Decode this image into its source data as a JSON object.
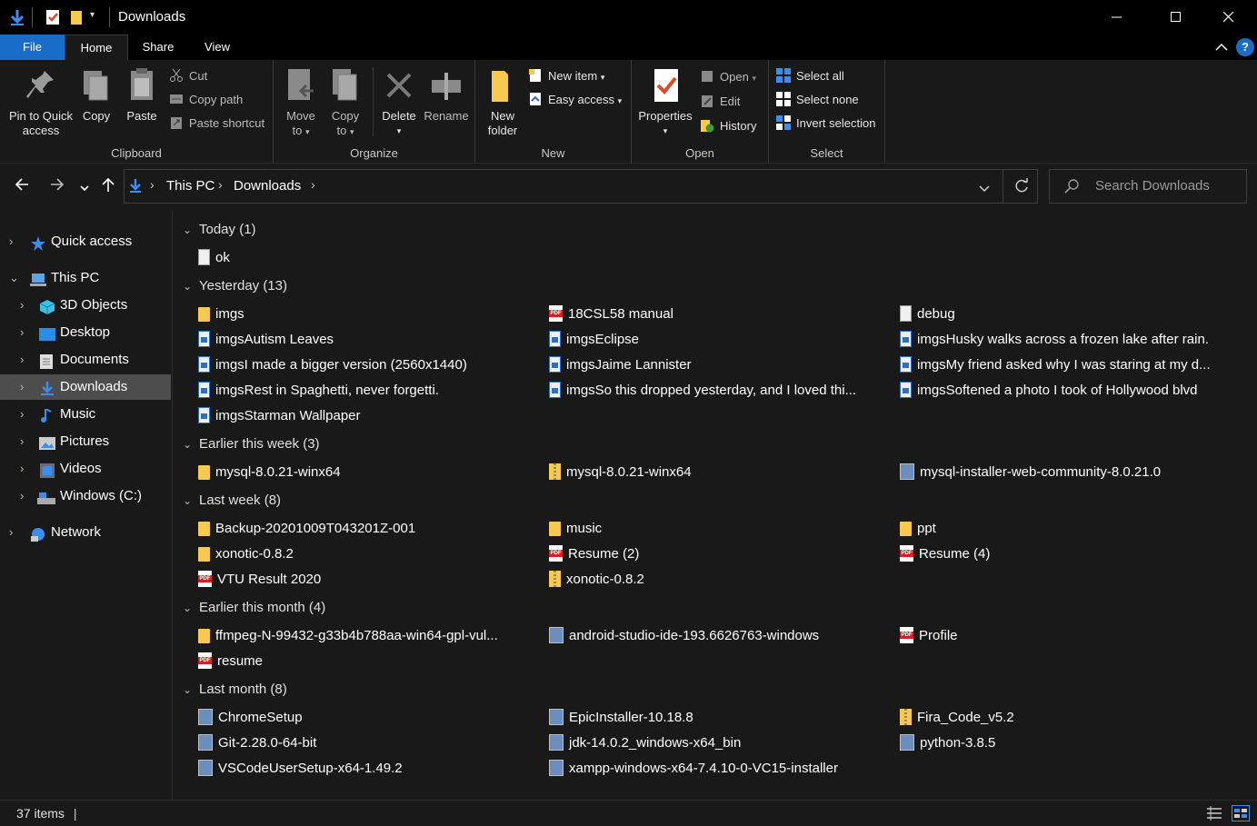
{
  "window": {
    "title": "Downloads",
    "accent": "#1a6cc9"
  },
  "ribbon_tabs": [
    "File",
    "Home",
    "Share",
    "View"
  ],
  "ribbon": {
    "clipboard": {
      "label": "Clipboard",
      "pin_line1": "Pin to Quick",
      "pin_line2": "access",
      "copy": "Copy",
      "paste": "Paste",
      "cut": "Cut",
      "copy_path": "Copy path",
      "paste_shortcut": "Paste shortcut"
    },
    "organize": {
      "label": "Organize",
      "move_line1": "Move",
      "move_line2": "to",
      "copy_line1": "Copy",
      "copy_line2": "to",
      "delete": "Delete",
      "rename": "Rename"
    },
    "new": {
      "label": "New",
      "new_folder_line1": "New",
      "new_folder_line2": "folder",
      "new_item": "New item",
      "easy_access": "Easy access"
    },
    "open": {
      "label": "Open",
      "properties": "Properties",
      "open": "Open",
      "edit": "Edit",
      "history": "History"
    },
    "select": {
      "label": "Select",
      "select_all": "Select all",
      "select_none": "Select none",
      "invert_selection": "Invert selection"
    }
  },
  "address": {
    "crumbs": [
      "This PC",
      "Downloads"
    ],
    "search_placeholder": "Search Downloads"
  },
  "sidebar": {
    "items": [
      {
        "label": "Quick access",
        "icon": "star-icon"
      },
      {
        "label": "This PC",
        "icon": "pc-icon"
      },
      {
        "label": "3D Objects",
        "icon": "cube-icon"
      },
      {
        "label": "Desktop",
        "icon": "desktop-icon"
      },
      {
        "label": "Documents",
        "icon": "documents-icon"
      },
      {
        "label": "Downloads",
        "icon": "download-icon"
      },
      {
        "label": "Music",
        "icon": "music-icon"
      },
      {
        "label": "Pictures",
        "icon": "pictures-icon"
      },
      {
        "label": "Videos",
        "icon": "videos-icon"
      },
      {
        "label": "Windows (C:)",
        "icon": "drive-icon"
      },
      {
        "label": "Network",
        "icon": "network-icon"
      }
    ]
  },
  "groups": [
    {
      "header": "Today (1)",
      "files": [
        {
          "name": "ok",
          "type": "doc"
        }
      ]
    },
    {
      "header": "Yesterday (13)",
      "files": [
        {
          "name": "imgs",
          "type": "folder"
        },
        {
          "name": "18CSL58 manual",
          "type": "pdf"
        },
        {
          "name": "debug",
          "type": "doc"
        },
        {
          "name": "imgsAutism Leaves",
          "type": "img"
        },
        {
          "name": "imgsEclipse",
          "type": "img"
        },
        {
          "name": "imgsHusky walks across a frozen lake after rain.",
          "type": "img"
        },
        {
          "name": "imgsI made a bigger version (2560x1440)",
          "type": "img"
        },
        {
          "name": "imgsJaime Lannister",
          "type": "img"
        },
        {
          "name": "imgsMy friend asked why I was staring at my d...",
          "type": "img"
        },
        {
          "name": "imgsRest in Spaghetti, never forgetti.",
          "type": "img"
        },
        {
          "name": "imgsSo this dropped yesterday, and I loved thi...",
          "type": "img"
        },
        {
          "name": "imgsSoftened a photo I took of Hollywood blvd",
          "type": "img"
        },
        {
          "name": "imgsStarman Wallpaper",
          "type": "img"
        }
      ]
    },
    {
      "header": "Earlier this week (3)",
      "files": [
        {
          "name": "mysql-8.0.21-winx64",
          "type": "folder"
        },
        {
          "name": "mysql-8.0.21-winx64",
          "type": "zip"
        },
        {
          "name": "mysql-installer-web-community-8.0.21.0",
          "type": "exe"
        }
      ]
    },
    {
      "header": "Last week (8)",
      "files": [
        {
          "name": "Backup-20201009T043201Z-001",
          "type": "folder"
        },
        {
          "name": "music",
          "type": "folder"
        },
        {
          "name": "ppt",
          "type": "folder"
        },
        {
          "name": "xonotic-0.8.2",
          "type": "folder"
        },
        {
          "name": "Resume (2)",
          "type": "pdf"
        },
        {
          "name": "Resume (4)",
          "type": "pdf"
        },
        {
          "name": "VTU Result 2020",
          "type": "pdf"
        },
        {
          "name": "xonotic-0.8.2",
          "type": "zip"
        }
      ]
    },
    {
      "header": "Earlier this month (4)",
      "files": [
        {
          "name": "ffmpeg-N-99432-g33b4b788aa-win64-gpl-vul...",
          "type": "folder"
        },
        {
          "name": "android-studio-ide-193.6626763-windows",
          "type": "exe"
        },
        {
          "name": "Profile",
          "type": "pdf"
        },
        {
          "name": "resume",
          "type": "pdf"
        }
      ]
    },
    {
      "header": "Last month (8)",
      "files": [
        {
          "name": "ChromeSetup",
          "type": "exe"
        },
        {
          "name": "EpicInstaller-10.18.8",
          "type": "exe"
        },
        {
          "name": "Fira_Code_v5.2",
          "type": "zip"
        },
        {
          "name": "Git-2.28.0-64-bit",
          "type": "exe"
        },
        {
          "name": "jdk-14.0.2_windows-x64_bin",
          "type": "exe"
        },
        {
          "name": "python-3.8.5",
          "type": "exe"
        },
        {
          "name": "VSCodeUserSetup-x64-1.49.2",
          "type": "exe"
        },
        {
          "name": "xampp-windows-x64-7.4.10-0-VC15-installer",
          "type": "exe"
        }
      ]
    }
  ],
  "status": {
    "item_count": "37 items"
  }
}
